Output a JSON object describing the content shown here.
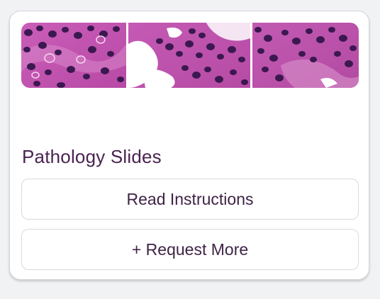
{
  "card": {
    "title": "Pathology Slides",
    "read_instructions_label": "Read Instructions",
    "request_more_label": "+ Request More"
  },
  "images": [
    {
      "name": "slide-thumbnail-1"
    },
    {
      "name": "slide-thumbnail-2"
    },
    {
      "name": "slide-thumbnail-3"
    }
  ],
  "colors": {
    "title": "#4a2452",
    "button_text": "#3f2346",
    "stain_background": "#c85bb6",
    "nuclei": "#3b1850"
  }
}
